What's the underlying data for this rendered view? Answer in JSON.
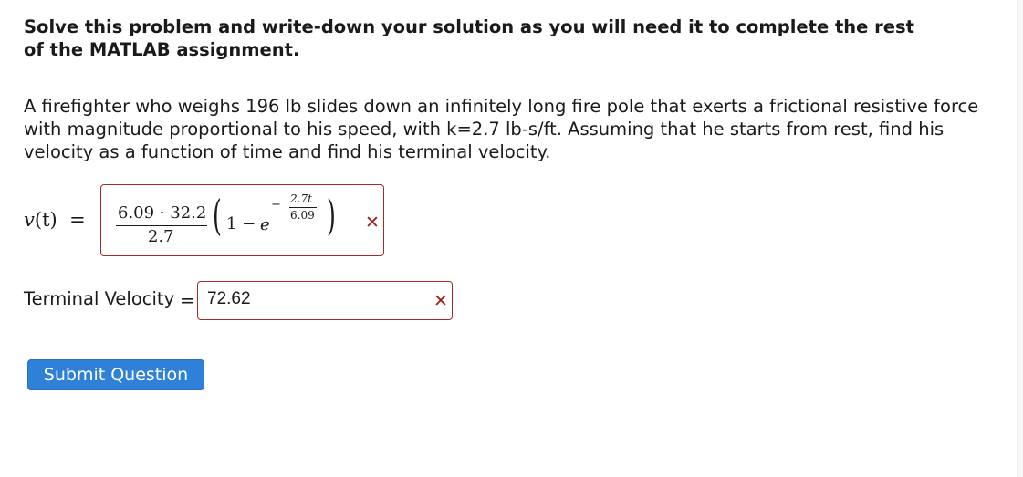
{
  "instructions": "Solve this problem and write-down your solution as you will need it to complete the rest of the MATLAB assignment.",
  "problem": "A firefighter who weighs 196 lb slides down an infinitely long fire pole that exerts a frictional resistive force with magnitude proportional to his speed, with k=2.7 lb-s/ft. Assuming that he starts from rest, find his velocity as a function of time and find his terminal velocity.",
  "velocity_answer": {
    "label_fn": "v",
    "label_arg": "(t)",
    "label_eq": "=",
    "numerator": "6.09 · 32.2",
    "denominator": "2.7",
    "paren_open": "(",
    "one_minus": "1 −",
    "base": "e",
    "exp_sign": "−",
    "exp_numerator": "2.7t",
    "exp_denominator": "6.09",
    "paren_close": ")",
    "status_icon": "✕",
    "status": "incorrect",
    "status_color": "#a31f1f"
  },
  "terminal_velocity": {
    "label": "Terminal Velocity",
    "equals": "=",
    "value": "72.62",
    "status_icon": "✕",
    "status": "incorrect"
  },
  "submit_button": {
    "label": "Submit Question",
    "color": "#2f80d8"
  }
}
